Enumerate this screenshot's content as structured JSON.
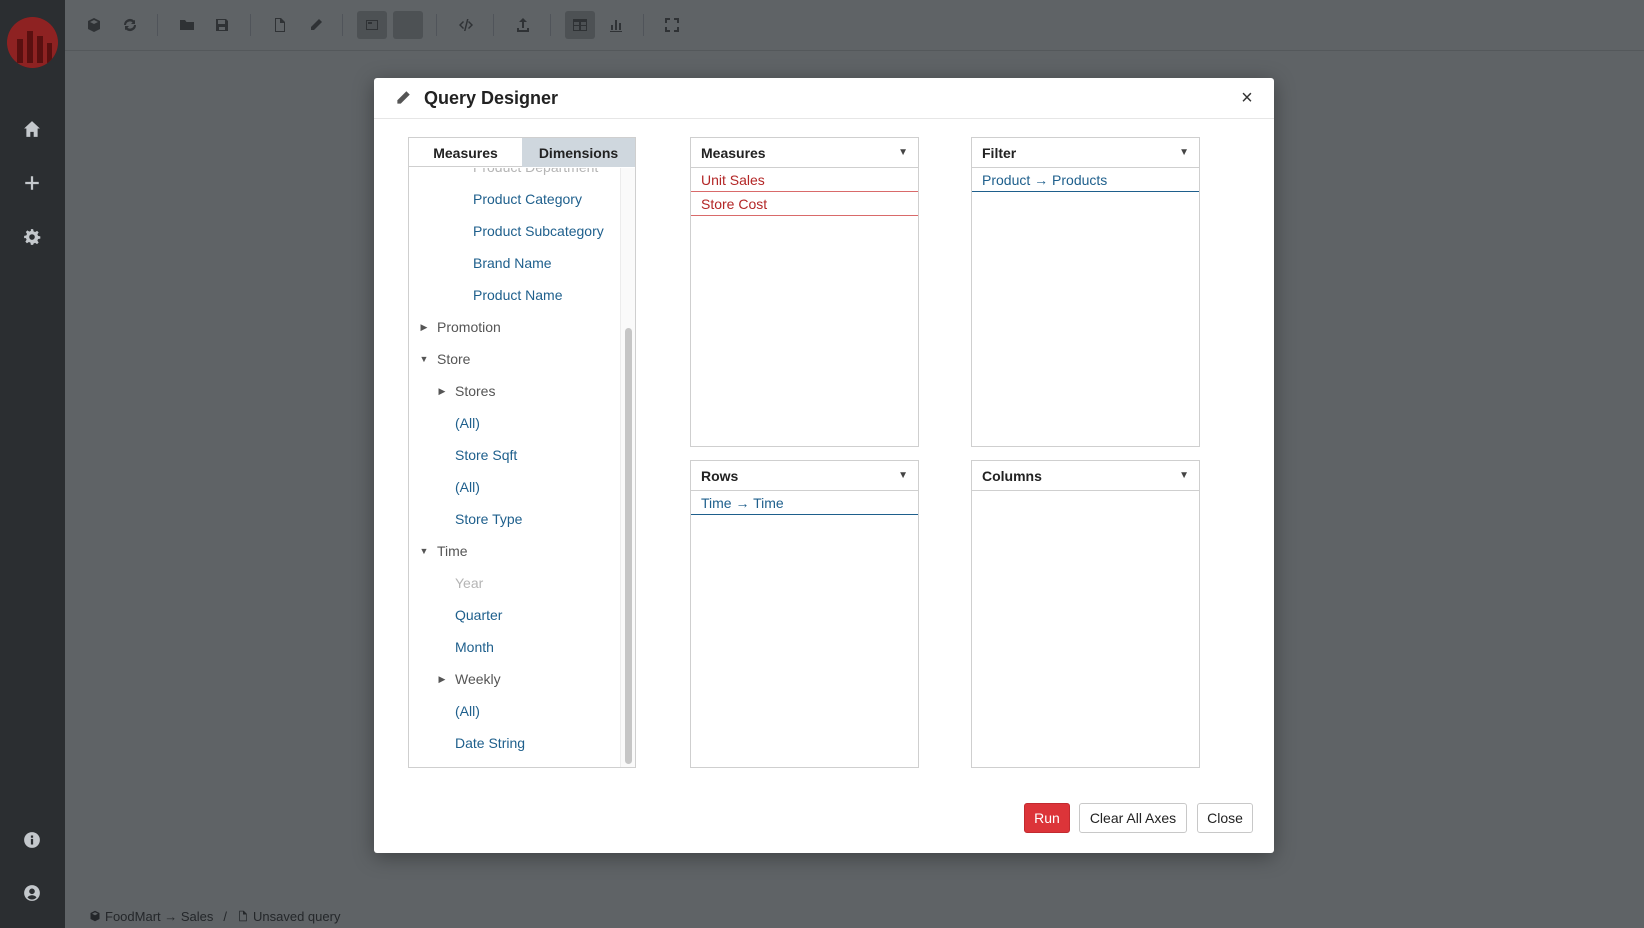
{
  "colors": {
    "sidebar_bg": "#2b2e31",
    "overlay_bg": "#5f6366",
    "accent_red": "#dc3439",
    "link_blue": "#1e5f8c",
    "measure_red": "#b32626",
    "tab_selected": "#cfd7de"
  },
  "sidebar": {
    "icons": [
      "home-icon",
      "plus-icon",
      "gear-icon",
      "info-icon",
      "user-icon"
    ]
  },
  "toolbar": {
    "icons": [
      "cube-icon",
      "refresh-icon",
      "folder-open-icon",
      "save-icon",
      "new-file-icon",
      "pencil-icon",
      "layout-icon",
      "layout-alt-icon",
      "code-icon",
      "export-icon",
      "table-icon",
      "chart-icon",
      "fullscreen-icon"
    ]
  },
  "footer": {
    "cube_path": "FoodMart → Sales",
    "separator": "/",
    "query_name": "Unsaved query"
  },
  "dialog": {
    "title": "Query Designer",
    "close_glyph": "×",
    "tabs": {
      "measures": "Measures",
      "dimensions": "Dimensions"
    },
    "tree": [
      {
        "label": "Product Department",
        "style": "muted"
      },
      {
        "label": "Product Category",
        "style": "link"
      },
      {
        "label": "Product Subcategory",
        "style": "link"
      },
      {
        "label": "Brand Name",
        "style": "link"
      },
      {
        "label": "Product Name",
        "style": "link"
      },
      {
        "label": "Promotion",
        "style": "dim",
        "caret": "collapsed"
      },
      {
        "label": "Store",
        "style": "dim",
        "caret": "expanded"
      },
      {
        "label": "Stores",
        "style": "dim",
        "caret": "collapsed"
      },
      {
        "label": "(All)",
        "style": "link"
      },
      {
        "label": "Store Sqft",
        "style": "link"
      },
      {
        "label": "(All)",
        "style": "link"
      },
      {
        "label": "Store Type",
        "style": "link"
      },
      {
        "label": "Time",
        "style": "dim",
        "caret": "expanded"
      },
      {
        "label": "Year",
        "style": "muted"
      },
      {
        "label": "Quarter",
        "style": "link"
      },
      {
        "label": "Month",
        "style": "link"
      },
      {
        "label": "Weekly",
        "style": "dim",
        "caret": "collapsed"
      },
      {
        "label": "(All)",
        "style": "link"
      },
      {
        "label": "Date String",
        "style": "link"
      }
    ],
    "axes": {
      "measures": {
        "title": "Measures",
        "items": [
          "Unit Sales",
          "Store Cost"
        ]
      },
      "filter": {
        "title": "Filter",
        "items": [
          "Product → Products"
        ]
      },
      "rows": {
        "title": "Rows",
        "items": [
          "Time → Time"
        ]
      },
      "columns": {
        "title": "Columns",
        "items": []
      }
    },
    "buttons": {
      "run": "Run",
      "clear": "Clear All Axes",
      "close": "Close"
    }
  }
}
